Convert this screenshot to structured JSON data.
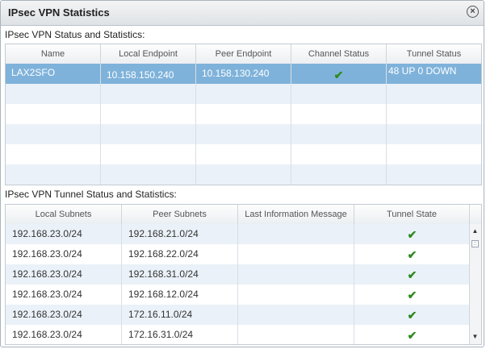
{
  "dialog": {
    "title": "IPsec VPN Statistics",
    "close_icon": "close-icon"
  },
  "status_section": {
    "label": "IPsec VPN Status and Statistics:",
    "columns": [
      "Name",
      "Local Endpoint",
      "Peer Endpoint",
      "Channel Status",
      "Tunnel Status"
    ],
    "rows": [
      {
        "name": "LAX2SFO",
        "local_endpoint": "10.158.150.240",
        "peer_endpoint": "10.158.130.240",
        "channel_status": "ok",
        "tunnel_status": "48 UP 0 DOWN"
      }
    ]
  },
  "tunnel_section": {
    "label": "IPsec VPN Tunnel Status and Statistics:",
    "columns": [
      "Local Subnets",
      "Peer Subnets",
      "Last Information Message",
      "Tunnel State"
    ],
    "rows": [
      {
        "local": "192.168.23.0/24",
        "peer": "192.168.21.0/24",
        "message": "",
        "state": "ok"
      },
      {
        "local": "192.168.23.0/24",
        "peer": "192.168.22.0/24",
        "message": "",
        "state": "ok"
      },
      {
        "local": "192.168.23.0/24",
        "peer": "192.168.31.0/24",
        "message": "",
        "state": "ok"
      },
      {
        "local": "192.168.23.0/24",
        "peer": "192.168.12.0/24",
        "message": "",
        "state": "ok"
      },
      {
        "local": "192.168.23.0/24",
        "peer": "172.16.11.0/24",
        "message": "",
        "state": "ok"
      },
      {
        "local": "192.168.23.0/24",
        "peer": "172.16.31.0/24",
        "message": "",
        "state": "ok"
      }
    ]
  },
  "colors": {
    "selected_row": "#7eb2da",
    "alt_row": "#eaf1f8",
    "check": "#3a9a28"
  }
}
